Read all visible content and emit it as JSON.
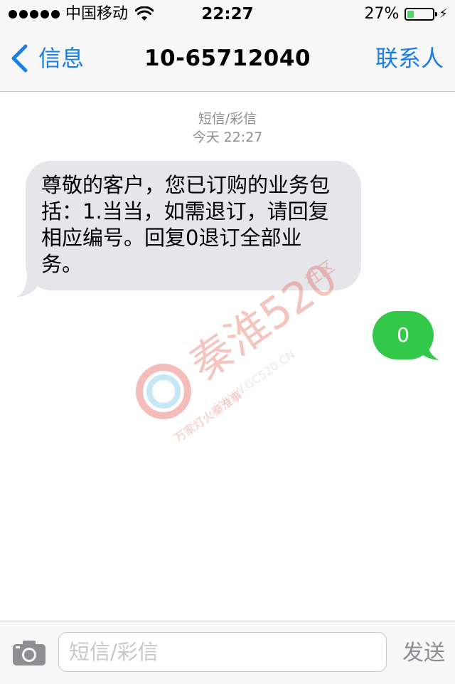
{
  "status_bar": {
    "carrier": "中国移动",
    "time": "22:27",
    "battery_percent_text": "27%",
    "battery_level": 0.27,
    "signal_dots": 5
  },
  "nav": {
    "back_label": "信息",
    "title": "10-65712040",
    "contact_label": "联系人"
  },
  "thread": {
    "service_type": "短信/彩信",
    "timestamp": "今天 22:27",
    "messages": [
      {
        "direction": "incoming",
        "text": "尊敬的客户，您已订购的业务包括：1.当当，如需退订，请回复相应编号。回复0退订全部业务。"
      },
      {
        "direction": "outgoing",
        "text": "0"
      }
    ]
  },
  "input_bar": {
    "placeholder": "短信/彩信",
    "value": "",
    "send_label": "发送"
  },
  "watermark": {
    "brand": "秦淮520",
    "tagline": "万家灯火秦淮事",
    "url": "WWW.GC520.CN",
    "side": "社区"
  },
  "colors": {
    "ios_blue": "#1a7ee6",
    "incoming_bubble": "#e5e5ea",
    "outgoing_bubble": "#34c84a",
    "battery_green": "#4cd964",
    "meta_gray": "#8e8e93"
  },
  "icons": {
    "back": "chevron-left-icon",
    "wifi": "wifi-icon",
    "battery": "battery-icon",
    "charging": "bolt-icon",
    "camera": "camera-icon"
  }
}
